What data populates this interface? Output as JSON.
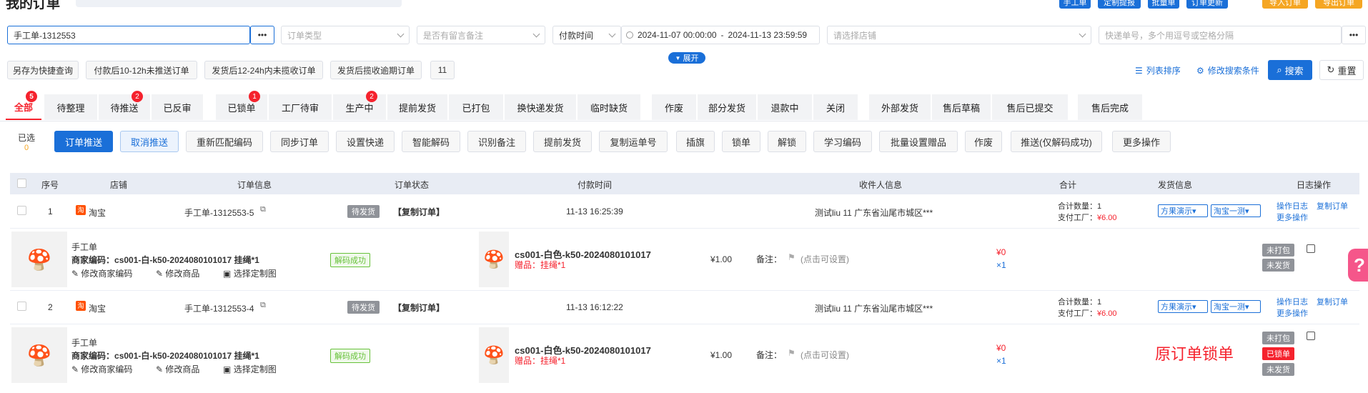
{
  "header": {
    "title": "我的订单",
    "buttons": [
      "手工单",
      "定制提报",
      "批量单",
      "订单更新",
      "导入订单",
      "导出订单"
    ]
  },
  "filters": {
    "order_no": "手工单-1312553",
    "more": "•••",
    "order_type_placeholder": "订单类型",
    "remark_placeholder": "是否有留言备注",
    "pay_time_label": "付款时间",
    "date_start": "2024-11-07 00:00:00",
    "date_sep": "-",
    "date_end": "2024-11-13 23:59:59",
    "shop_placeholder": "请选择店铺",
    "express_placeholder": "快递单号，多个用逗号或空格分隔",
    "express_more": "•••"
  },
  "quick": {
    "items": [
      "另存为快捷查询",
      "付款后10-12h未推送订单",
      "发货后12-24h内未揽收订单",
      "发货后揽收逾期订单",
      "11"
    ],
    "expand": "展开",
    "list_sort": "列表排序",
    "edit_conditions": "修改搜索条件",
    "search": "搜索",
    "reset": "重置"
  },
  "tabs": [
    {
      "label": "全部",
      "badge": "5"
    },
    {
      "label": "待整理",
      "badge": ""
    },
    {
      "label": "待推送",
      "badge": "2"
    },
    {
      "label": "已反审",
      "badge": ""
    },
    {
      "label": "已锁单",
      "badge": "1"
    },
    {
      "label": "工厂待审",
      "badge": ""
    },
    {
      "label": "生产中",
      "badge": "2"
    },
    {
      "label": "提前发货",
      "badge": ""
    },
    {
      "label": "已打包",
      "badge": ""
    },
    {
      "label": "换快递发货",
      "badge": ""
    },
    {
      "label": "临时缺货",
      "badge": ""
    },
    {
      "label": "作废",
      "badge": ""
    },
    {
      "label": "部分发货",
      "badge": ""
    },
    {
      "label": "退款中",
      "badge": ""
    },
    {
      "label": "关闭",
      "badge": ""
    },
    {
      "label": "外部发货",
      "badge": ""
    },
    {
      "label": "售后草稿",
      "badge": ""
    },
    {
      "label": "售后已提交",
      "badge": ""
    },
    {
      "label": "售后完成",
      "badge": ""
    }
  ],
  "actions": {
    "selected_label": "已选",
    "selected_count": "0",
    "buttons": [
      "订单推送",
      "取消推送",
      "重新匹配编码",
      "同步订单",
      "设置快递",
      "智能解码",
      "识别备注",
      "提前发货",
      "复制运单号",
      "插旗",
      "锁单",
      "解锁",
      "学习编码",
      "批量设置赠品",
      "作废",
      "推送(仅解码成功)",
      "更多操作"
    ]
  },
  "table": {
    "headers": [
      "序号",
      "店铺",
      "订单信息",
      "订单状态",
      "付款时间",
      "收件人信息",
      "合计",
      "发货信息",
      "日志操作"
    ]
  },
  "orders": [
    {
      "index": "1",
      "shop": "淘宝",
      "order_no": "手工单-1312553-5",
      "status": "待发货",
      "copy": "【复制订单】",
      "pay_time": "11-13 16:25:39",
      "recipient": "测试liu 11 广东省汕尾市城区***",
      "total_qty": "合计数量：1",
      "factory_pay_label": "支付工厂：",
      "factory_pay": "¥6.00",
      "ship_sel1": "方果演示",
      "ship_sel2": "淘宝一测",
      "log": "操作日志",
      "copy_order": "复制订单",
      "more": "更多操作",
      "item_title": "手工单",
      "merchant_code_label": "商家编码：",
      "merchant_code": "cs001-白-k50-2024080101017  挂绳*1",
      "decode": "解码成功",
      "edit_code": "修改商家编码",
      "edit_goods": "修改商品",
      "choose_img": "选择定制图",
      "sku": "cs001-白色-k50-2024080101017",
      "gift_label": "赠品：",
      "gift": "挂绳*1",
      "price": "¥1.00",
      "remark_label": "备注：",
      "remark": "(点击可设置)",
      "amount": "¥0",
      "qty": "×1",
      "pack": "未打包",
      "lock": "",
      "ship": "未发货",
      "note": ""
    },
    {
      "index": "2",
      "shop": "淘宝",
      "order_no": "手工单-1312553-4",
      "status": "待发货",
      "copy": "【复制订单】",
      "pay_time": "11-13 16:12:22",
      "recipient": "测试liu 11 广东省汕尾市城区***",
      "total_qty": "合计数量：1",
      "factory_pay_label": "支付工厂：",
      "factory_pay": "¥6.00",
      "ship_sel1": "方果演示",
      "ship_sel2": "淘宝一测",
      "log": "操作日志",
      "copy_order": "复制订单",
      "more": "更多操作",
      "item_title": "手工单",
      "merchant_code_label": "商家编码：",
      "merchant_code": "cs001-白-k50-2024080101017  挂绳*1",
      "decode": "解码成功",
      "edit_code": "修改商家编码",
      "edit_goods": "修改商品",
      "choose_img": "选择定制图",
      "sku": "cs001-白色-k50-2024080101017",
      "gift_label": "赠品：",
      "gift": "挂绳*1",
      "price": "¥1.00",
      "remark_label": "备注：",
      "remark": "(点击可设置)",
      "amount": "¥0",
      "qty": "×1",
      "pack": "未打包",
      "lock": "已锁单",
      "ship": "未发货",
      "note": "原订单锁单"
    }
  ],
  "colors": {
    "primary": "#1a6fd8",
    "danger": "#f5222d",
    "orange": "#f5a623",
    "tab_bg": "#f2f3f5"
  }
}
